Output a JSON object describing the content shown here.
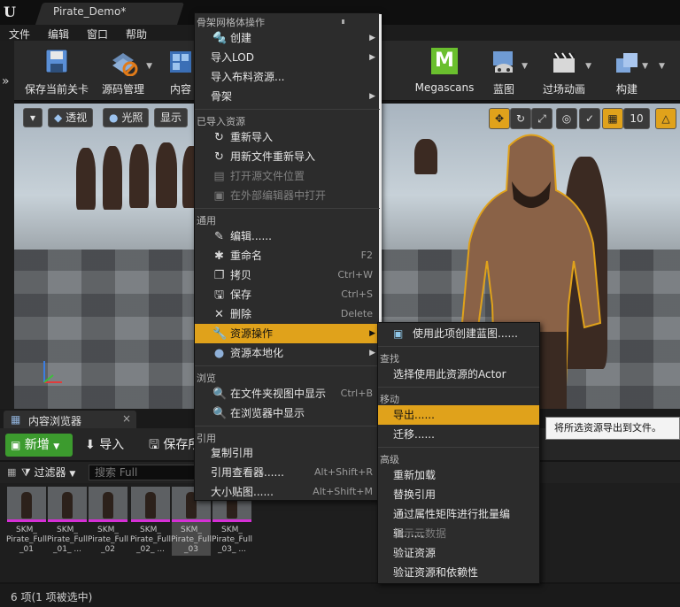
{
  "window": {
    "tab_title": "Pirate_Demo*",
    "logo": "U"
  },
  "menubar": [
    "文件",
    "编辑",
    "窗口",
    "帮助"
  ],
  "toolbar": {
    "save_level": "保存当前关卡",
    "source_control": "源码管理",
    "content": "内容",
    "megascans": "Megascans",
    "megascans_logo": "M",
    "blueprint": "蓝图",
    "cinematics": "过场动画",
    "build": "构建"
  },
  "viewport": {
    "perspective": "透视",
    "lighting": "光照",
    "show": "显示",
    "grid_snap_value": "10"
  },
  "context_menu": {
    "section_skeletal_mesh": "骨架网格体操作",
    "create": "创建",
    "import_lod": "导入LOD",
    "import_cloth": "导入布料资源...",
    "skeleton": "骨架",
    "section_imported": "已导入资源",
    "reimport": "重新导入",
    "reimport_new_file": "用新文件重新导入",
    "open_source_location": "打开源文件位置",
    "open_external_editor": "在外部编辑器中打开",
    "section_common": "通用",
    "edit": "编辑......",
    "rename": "重命名",
    "rename_sc": "F2",
    "duplicate": "拷贝",
    "duplicate_sc": "Ctrl+W",
    "save": "保存",
    "save_sc": "Ctrl+S",
    "delete": "删除",
    "delete_sc": "Delete",
    "asset_actions": "资源操作",
    "asset_localization": "资源本地化",
    "section_browse": "浏览",
    "show_in_folder": "在文件夹视图中显示",
    "show_in_folder_sc": "Ctrl+B",
    "show_in_explorer": "在浏览器中显示",
    "section_references": "引用",
    "copy_reference": "复制引用",
    "reference_viewer": "引用查看器......",
    "reference_viewer_sc": "Alt+Shift+R",
    "size_map": "大小贴图......",
    "size_map_sc": "Alt+Shift+M"
  },
  "submenu": {
    "create_blueprint": "使用此项创建蓝图......",
    "section_find": "查找",
    "select_actors": "选择使用此资源的Actor",
    "section_move": "移动",
    "export": "导出......",
    "migrate": "迁移......",
    "section_advanced": "高级",
    "bulk_reload": "重新加载",
    "replace_references": "替换引用",
    "property_matrix": "通过属性矩阵进行批量编辑......",
    "show_metadata": "显示元数据",
    "validate": "验证资源",
    "validate_deps": "验证资源和依赖性"
  },
  "tooltip": "将所选资源导出到文件。",
  "content_browser": {
    "tab_label": "内容浏览器",
    "tab_close": "×",
    "new_button": "新增",
    "import_button": "导入",
    "save_all_button": "保存所",
    "filters": "过滤器",
    "search_placeholder": "搜索 Full",
    "assets": [
      {
        "name": "SKM_ Pirate_Full _01"
      },
      {
        "name": "SKM_ Pirate_Full _01_ ..."
      },
      {
        "name": "SKM_ Pirate_Full _02"
      },
      {
        "name": "SKM_ Pirate_Full _02_ ..."
      },
      {
        "name": "SKM_ Pirate_Full _03",
        "selected": true
      },
      {
        "name": "SKM_ Pirate_Full _03_ ..."
      }
    ],
    "status": "6 项(1 项被选中)"
  },
  "colors": {
    "highlight": "#e0a21b",
    "new_button": "#3c9b2e",
    "selection_bar": "#d52fd5"
  }
}
